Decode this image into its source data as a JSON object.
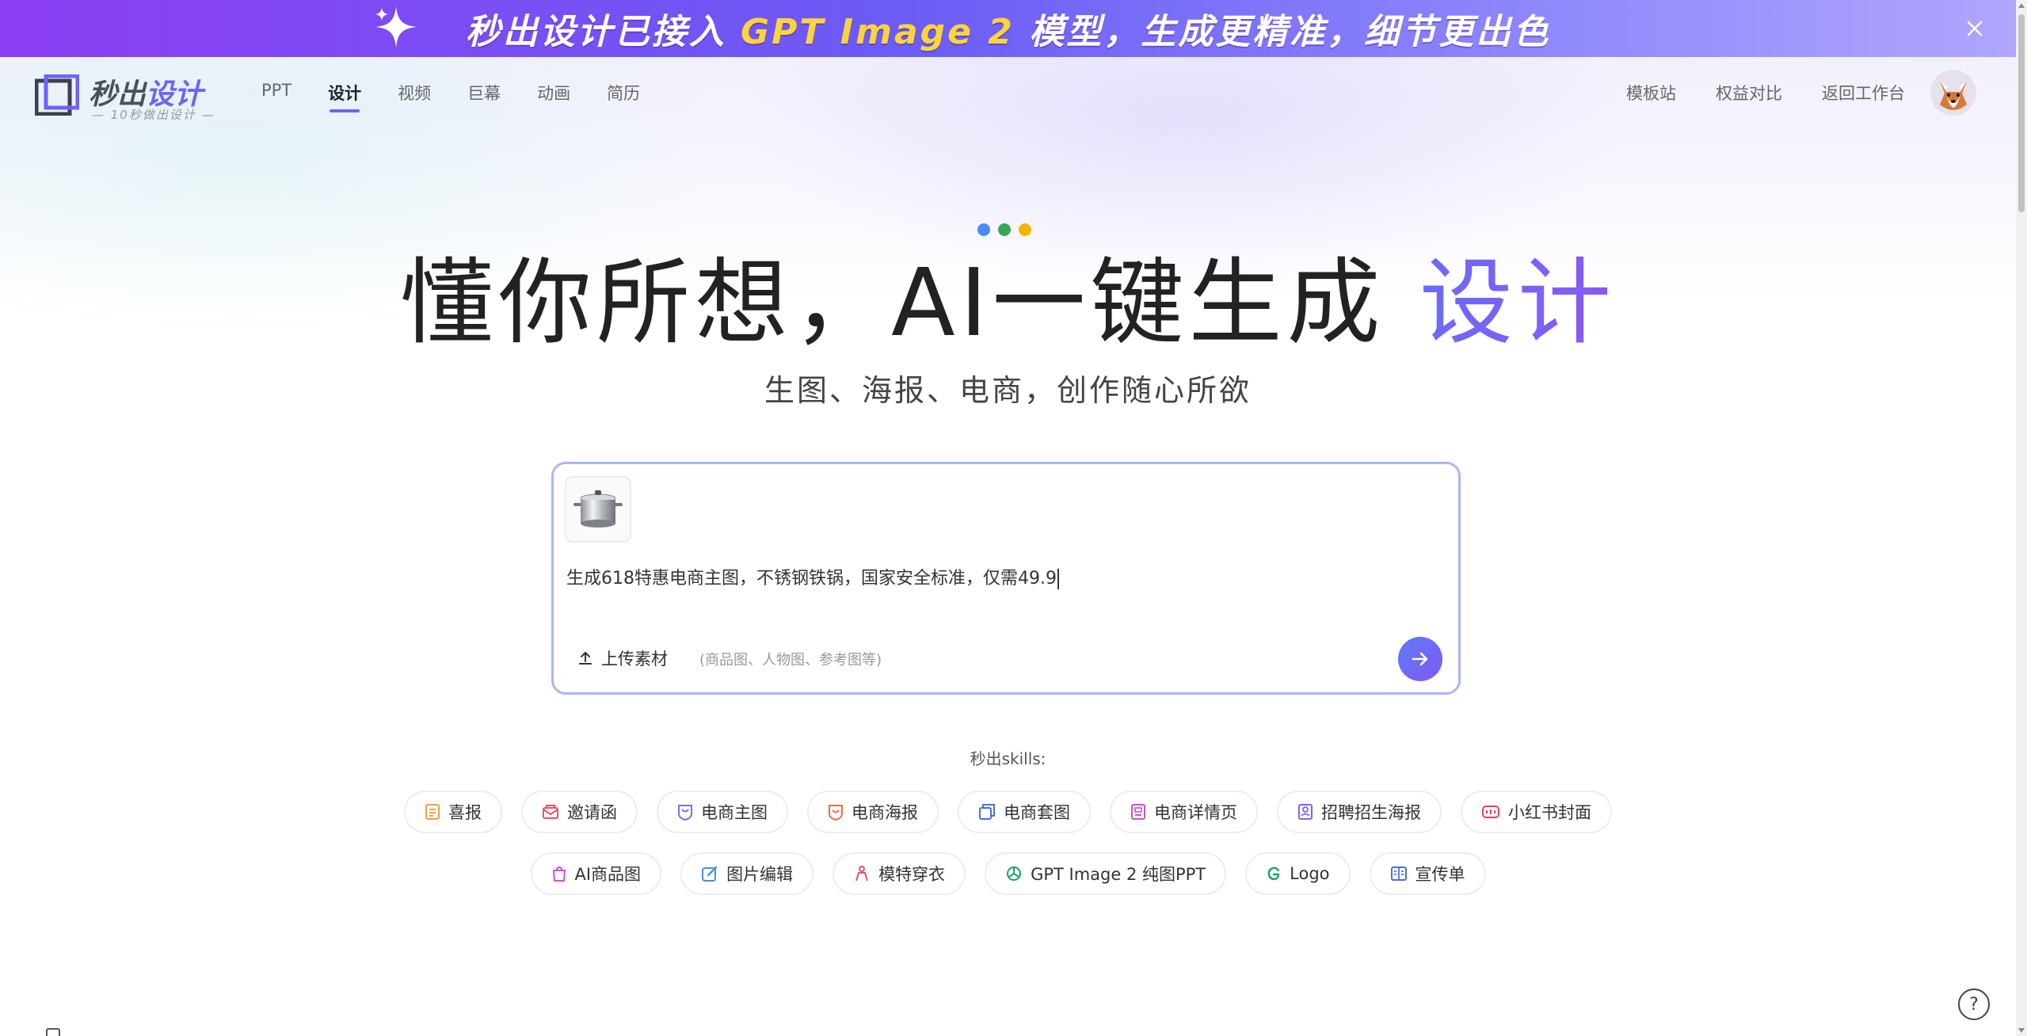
{
  "banner": {
    "text_pre": "秒出设计已接入",
    "text_highlight": "GPT Image 2",
    "text_post": "模型，生成更精准，细节更出色",
    "close_icon": "close-icon"
  },
  "logo": {
    "title_a": "秒出",
    "title_b": "设计",
    "subtitle": "— 10秒做出设计 —"
  },
  "nav": {
    "items": [
      "PPT",
      "设计",
      "视频",
      "巨幕",
      "动画",
      "简历"
    ],
    "active": "设计"
  },
  "right_nav": {
    "items": [
      "模板站",
      "权益对比",
      "返回工作台"
    ]
  },
  "hero": {
    "title_main": "懂你所想，AI一键生成",
    "title_accent": "设计",
    "subtitle": "生图、海报、电商，创作随心所欲"
  },
  "prompt": {
    "text": "生成618特惠电商主图，不锈钢铁锅，国家安全标准，仅需49.9",
    "upload_label": "上传素材",
    "upload_hint": "(商品图、人物图、参考图等)"
  },
  "skills": {
    "label": "秒出skills:",
    "row1": [
      {
        "label": "喜报",
        "icon": "report-icon",
        "color": "#f0a04b"
      },
      {
        "label": "邀请函",
        "icon": "envelope-icon",
        "color": "#e8506a"
      },
      {
        "label": "电商主图",
        "icon": "shield-bag-icon",
        "color": "#7b6cf3"
      },
      {
        "label": "电商海报",
        "icon": "poster-icon",
        "color": "#f06a4a"
      },
      {
        "label": "电商套图",
        "icon": "stack-icon",
        "color": "#4a6cf0"
      },
      {
        "label": "电商详情页",
        "icon": "detail-page-icon",
        "color": "#c84fd8"
      },
      {
        "label": "招聘招生海报",
        "icon": "recruit-icon",
        "color": "#8a5cf0"
      },
      {
        "label": "小红书封面",
        "icon": "xiaohongshu-icon",
        "color": "#ee3f5b"
      }
    ],
    "row2": [
      {
        "label": "AI商品图",
        "icon": "shopping-bag-icon",
        "color": "#d34fd6"
      },
      {
        "label": "图片编辑",
        "icon": "image-edit-icon",
        "color": "#3e8ff0"
      },
      {
        "label": "模特穿衣",
        "icon": "model-icon",
        "color": "#e8506a"
      },
      {
        "label": "GPT Image 2 纯图PPT",
        "icon": "openai-icon",
        "color": "#22a06b"
      },
      {
        "label": "Logo",
        "icon": "logo-g-icon",
        "color": "#22a06b"
      },
      {
        "label": "宣传单",
        "icon": "flyer-icon",
        "color": "#4a6cf0"
      }
    ]
  },
  "colors": {
    "accent": "#6d63f4",
    "dot_blue": "#4a8af4",
    "dot_green": "#34a853",
    "dot_yellow": "#f4b400"
  },
  "help": "?"
}
